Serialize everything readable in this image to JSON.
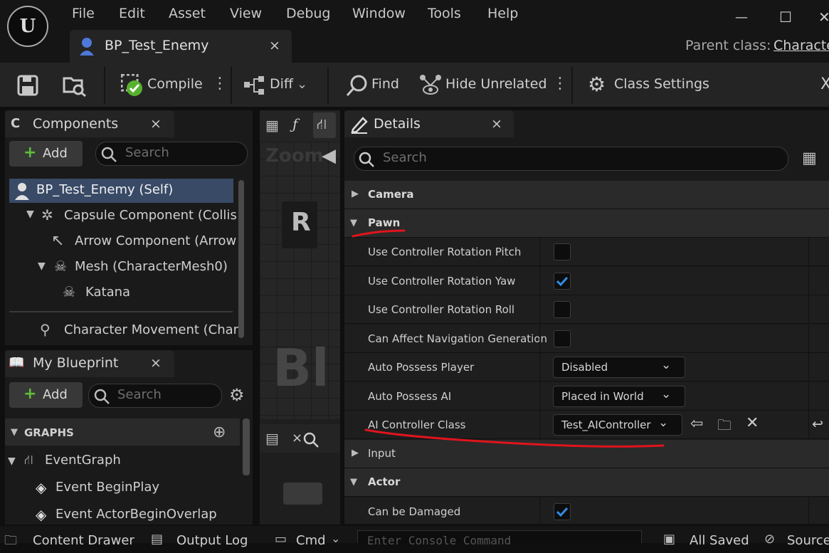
{
  "menu": [
    "File",
    "Edit",
    "Asset",
    "View",
    "Debug",
    "Window",
    "Tools",
    "Help"
  ],
  "window_controls": {
    "minimize": "—",
    "maximize": "☐",
    "close": "✕"
  },
  "asset_tab": {
    "label": "BP_Test_Enemy",
    "close": "×"
  },
  "parent_class": {
    "label": "Parent class:",
    "value": "Characte"
  },
  "toolbar": {
    "compile": "Compile",
    "diff": "Diff",
    "find": "Find",
    "hide_unrelated": "Hide Unrelated",
    "class_settings": "Class Settings"
  },
  "components": {
    "title": "Components",
    "close": "×",
    "add": "Add",
    "search_placeholder": "Search",
    "items": [
      "BP_Test_Enemy (Self)",
      "Capsule Component (Collis",
      "Arrow Component (Arrow",
      "Mesh (CharacterMesh0)",
      "Katana",
      "Character Movement (Char"
    ]
  },
  "my_blueprint": {
    "title": "My Blueprint",
    "close": "×",
    "add": "Add",
    "search_placeholder": "Search",
    "graphs_header": "GRAPHS",
    "items": [
      "EventGraph",
      "Event BeginPlay",
      "Event ActorBeginOverlap"
    ]
  },
  "viewport": {
    "r_label": "R",
    "bl_label": "Bl",
    "zoom_label": "Zoom"
  },
  "details": {
    "title": "Details",
    "close": "×",
    "search_placeholder": "Search",
    "categories": {
      "camera": "Camera",
      "pawn": "Pawn",
      "input": "Input",
      "actor": "Actor"
    },
    "properties": {
      "pitch": {
        "label": "Use Controller Rotation Pitch",
        "checked": false
      },
      "yaw": {
        "label": "Use Controller Rotation Yaw",
        "checked": true
      },
      "roll": {
        "label": "Use Controller Rotation Roll",
        "checked": false
      },
      "nav": {
        "label": "Can Affect Navigation Generation",
        "checked": false
      },
      "auto_player": {
        "label": "Auto Possess Player",
        "value": "Disabled"
      },
      "auto_ai": {
        "label": "Auto Possess AI",
        "value": "Placed in World"
      },
      "ai_controller": {
        "label": "AI Controller Class",
        "value": "Test_AIController"
      },
      "damaged": {
        "label": "Can be Damaged",
        "checked": true
      }
    }
  },
  "bottom_bar": {
    "content_drawer": "Content Drawer",
    "output_log": "Output Log",
    "cmd": "Cmd",
    "console_placeholder": "Enter Console Command",
    "saved": "All Saved",
    "source": "Source"
  },
  "colors": {
    "annotation": "#e0141c",
    "checkmark": "#2f8ee6",
    "accent_add": "#5fbf3a"
  }
}
